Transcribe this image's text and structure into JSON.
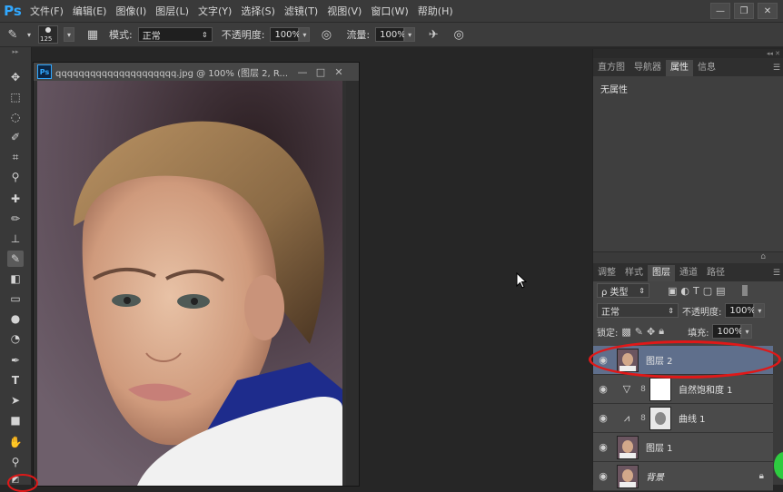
{
  "app": {
    "logo": "Ps"
  },
  "menu": [
    "文件(F)",
    "编辑(E)",
    "图像(I)",
    "图层(L)",
    "文字(Y)",
    "选择(S)",
    "滤镜(T)",
    "视图(V)",
    "窗口(W)",
    "帮助(H)"
  ],
  "window_controls": [
    "—",
    "❐",
    "✕"
  ],
  "options": {
    "brush_size": "125",
    "mode_label": "模式:",
    "mode_value": "正常",
    "opacity_label": "不透明度:",
    "opacity_value": "100%",
    "flow_label": "流量:",
    "flow_value": "100%"
  },
  "document": {
    "icon": "Ps",
    "title": "qqqqqqqqqqqqqqqqqqqqq.jpg @ 100% (图层 2, R...",
    "controls": [
      "—",
      "□",
      "✕"
    ]
  },
  "panel_top": {
    "tabs": [
      "直方图",
      "导航器",
      "属性",
      "信息"
    ],
    "active_tab": "属性",
    "content": "无属性"
  },
  "layers_panel": {
    "tabs": [
      "调整",
      "样式",
      "图层",
      "通道",
      "路径"
    ],
    "active_tab": "图层",
    "filter_label": "ρ 类型",
    "blend_mode": "正常",
    "opacity_label": "不透明度:",
    "opacity_value": "100%",
    "lock_label": "锁定:",
    "fill_label": "填充:",
    "fill_value": "100%",
    "layers": [
      {
        "name": "图层 2",
        "selected": true
      },
      {
        "name": "自然饱和度 1",
        "selected": false
      },
      {
        "name": "曲线 1",
        "selected": false
      },
      {
        "name": "图层 1",
        "selected": false
      },
      {
        "name": "背景",
        "selected": false
      }
    ]
  },
  "colors": {
    "accent": "#31a8ff",
    "highlight": "#e01818",
    "selection": "#5f6f8c"
  }
}
